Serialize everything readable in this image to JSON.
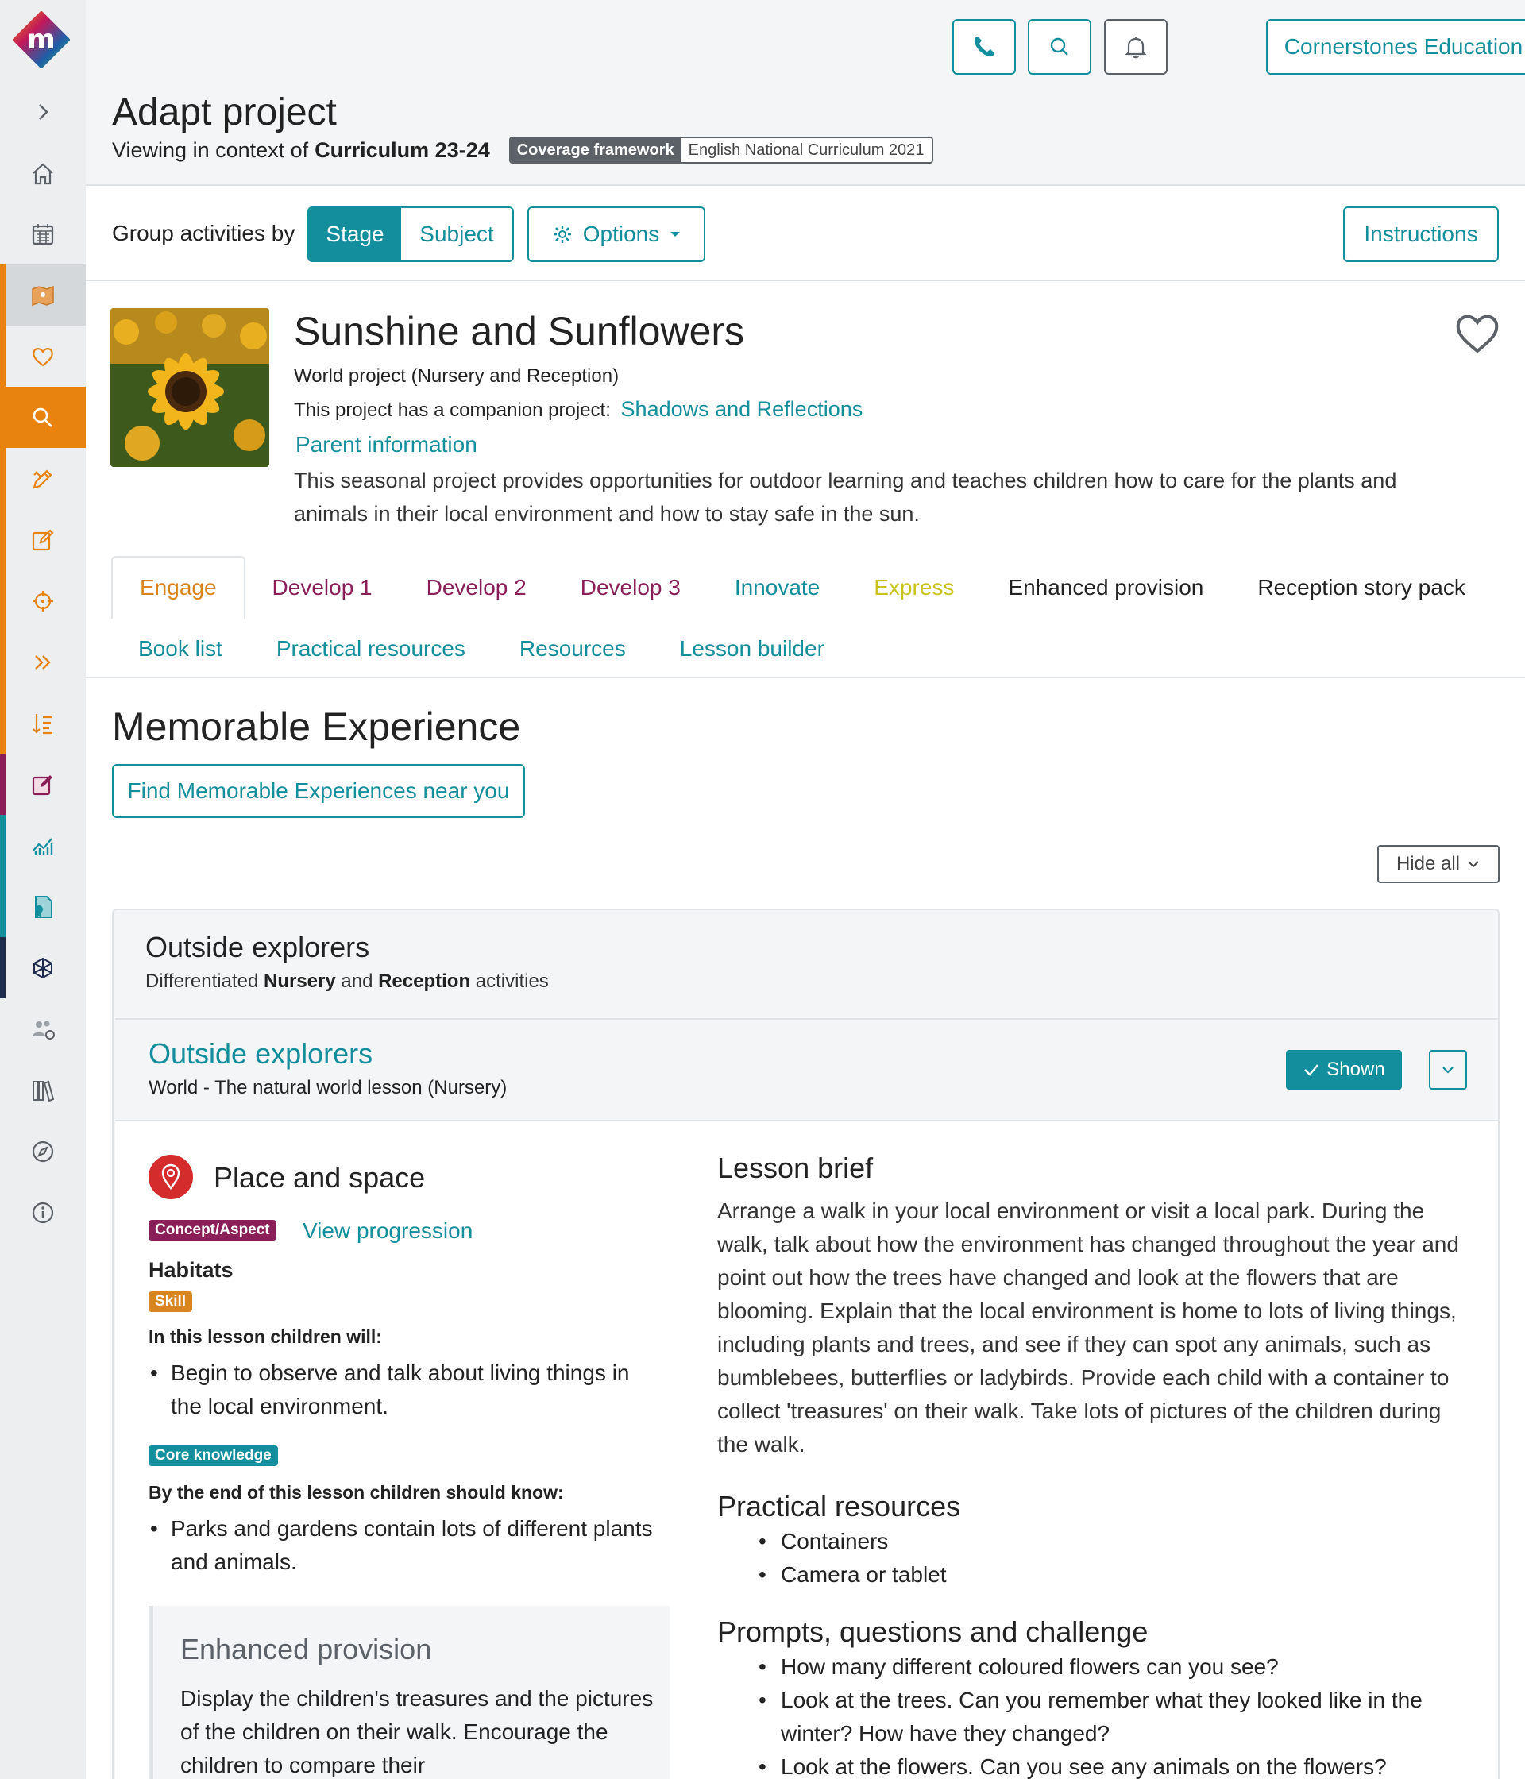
{
  "header": {
    "school": "Cornerstones Education",
    "page_title": "Adapt project",
    "context_prefix": "Viewing in context of",
    "context_value": "Curriculum 23-24",
    "framework_key": "Coverage framework",
    "framework_value": "English National Curriculum 2021"
  },
  "toolbar": {
    "group_label": "Group activities by",
    "stage": "Stage",
    "subject": "Subject",
    "options": "Options",
    "instructions": "Instructions"
  },
  "project": {
    "title": "Sunshine and Sunflowers",
    "type": "World project (Nursery and Reception)",
    "companion_prefix": "This project has a companion project:",
    "companion_link": "Shadows and Reflections",
    "parent_info": "Parent information",
    "description": "This seasonal project provides opportunities for outdoor learning and teaches children how to care for the plants and animals in their local environment and how to stay safe in the sun."
  },
  "tabs": {
    "row1": [
      {
        "label": "Engage",
        "color": "#d9851f"
      },
      {
        "label": "Develop 1",
        "color": "#8a1f58"
      },
      {
        "label": "Develop 2",
        "color": "#8a1f58"
      },
      {
        "label": "Develop 3",
        "color": "#8a1f58"
      },
      {
        "label": "Innovate",
        "color": "#138e9c"
      },
      {
        "label": "Express",
        "color": "#c8c21e"
      },
      {
        "label": "Enhanced provision",
        "color": "#222222"
      },
      {
        "label": "Reception story pack",
        "color": "#222222"
      }
    ],
    "row2": [
      {
        "label": "Book list"
      },
      {
        "label": "Practical resources"
      },
      {
        "label": "Resources"
      },
      {
        "label": "Lesson builder"
      }
    ]
  },
  "section": {
    "title": "Memorable Experience",
    "find_button": "Find Memorable Experiences near you",
    "hide_all": "Hide all"
  },
  "activity": {
    "title": "Outside explorers",
    "sub_prefix": "Differentiated",
    "sub_nursery": "Nursery",
    "sub_and": "and",
    "sub_reception": "Reception",
    "sub_suffix": "activities",
    "lesson_title": "Outside explorers",
    "lesson_sub": "World - The natural world lesson (Nursery)",
    "shown": "Shown"
  },
  "lesson": {
    "area_title": "Place and space",
    "concept_badge": "Concept/Aspect",
    "view_progression": "View progression",
    "concept": "Habitats",
    "skill_badge": "Skill",
    "skill_intro": "In this lesson children will:",
    "skill_items": [
      "Begin to observe and talk about living things in the local environment."
    ],
    "core_badge": "Core knowledge",
    "core_intro": "By the end of this lesson children should know:",
    "core_items": [
      "Parks and gardens contain lots of different plants and animals."
    ],
    "enhanced_title": "Enhanced provision",
    "enhanced_text": "Display the children's treasures and the pictures of the children on their walk. Encourage the children to compare their",
    "brief_title": "Lesson brief",
    "brief_text": "Arrange a walk in your local environment or visit a local park. During the walk, talk about how the environment has changed throughout the year and point out how the trees have changed and look at the flowers that are blooming. Explain that the local environment is home to lots of living things, including plants and trees, and see if they can spot any animals, such as bumblebees, butterflies or ladybirds. Provide each child with a container to collect 'treasures' on their walk. Take lots of pictures of the children during the walk.",
    "resources_title": "Practical resources",
    "resources": [
      "Containers",
      "Camera or tablet"
    ],
    "prompts_title": "Prompts, questions and challenge",
    "prompts": [
      "How many different coloured flowers can you see?",
      "Look at the trees. Can you remember what they looked like in the winter? How have they changed?",
      "Look at the flowers. Can you see any animals on the flowers?"
    ]
  },
  "colors": {
    "teal": "#138e9c",
    "orange": "#e8830f",
    "purple": "#8a1f58",
    "navy": "#1e2b4a"
  }
}
